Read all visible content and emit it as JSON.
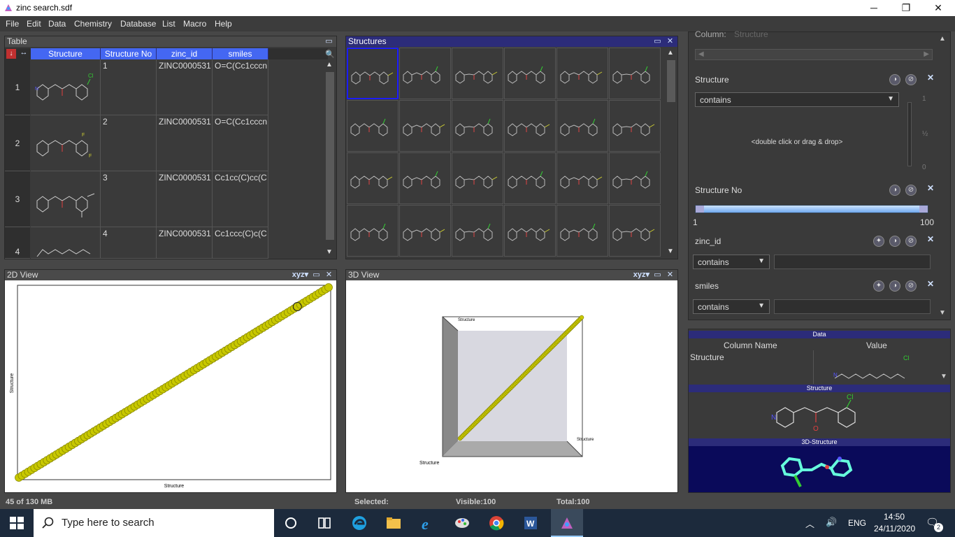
{
  "window": {
    "title": "zinc search.sdf",
    "minimize": "─",
    "restore": "❐",
    "close": "✕"
  },
  "menu": [
    "File",
    "Edit",
    "Data",
    "Chemistry",
    "Database",
    "List",
    "Macro",
    "Help"
  ],
  "table_panel": {
    "title": "Table",
    "columns": [
      "Structure",
      "Structure No",
      "zinc_id",
      "smiles"
    ],
    "rows": [
      {
        "num": "1",
        "structure_no": "1",
        "zinc_id": "ZINC0000531",
        "smiles": "O=C(Cc1cccn"
      },
      {
        "num": "2",
        "structure_no": "2",
        "zinc_id": "ZINC0000531",
        "smiles": "O=C(Cc1cccn"
      },
      {
        "num": "3",
        "structure_no": "3",
        "zinc_id": "ZINC0000531",
        "smiles": "Cc1cc(C)cc(C"
      },
      {
        "num": "4",
        "structure_no": "4",
        "zinc_id": "ZINC0000531",
        "smiles": "Cc1ccc(C)c(C"
      }
    ]
  },
  "structures_panel": {
    "title": "Structures"
  },
  "view2d": {
    "title": "2D View",
    "xyz": "xyz",
    "xlabel": "Structure",
    "ylabel": "Structure"
  },
  "view3d": {
    "title": "3D View",
    "xyz": "xyz",
    "axis_top": "Structure",
    "axis_right": "Structure",
    "axis_bottom": "Structure"
  },
  "query_panel": {
    "column_label": "Column:",
    "column_value": "Structure",
    "structure": {
      "label": "Structure",
      "mode": "contains",
      "hint": "<double click or drag & drop>",
      "slider_labels": [
        "1",
        "½",
        "0"
      ]
    },
    "structure_no": {
      "label": "Structure No",
      "min": "1",
      "max": "100"
    },
    "zinc_id": {
      "label": "zinc_id",
      "mode": "contains"
    },
    "smiles": {
      "label": "smiles",
      "mode": "contains"
    }
  },
  "data_panel": {
    "title": "Data",
    "col_name_header": "Column Name",
    "value_header": "Value",
    "row_name": "Structure",
    "structure_label": "Structure",
    "structure3d_label": "3D-Structure"
  },
  "status": {
    "memory": "45 of 130 MB",
    "selected": "Selected:",
    "visible": "Visible:100",
    "total": "Total:100"
  },
  "taskbar": {
    "search_placeholder": "Type here to search",
    "lang": "ENG",
    "time": "14:50",
    "date": "24/11/2020",
    "notif": "2"
  },
  "colors": {
    "accent": "#4467f2",
    "panel_title": "#2c2c7a",
    "points": "#c8c800"
  },
  "chart_data": [
    {
      "type": "scatter",
      "title": "2D View",
      "xlabel": "Structure",
      "ylabel": "Structure",
      "x": [
        1,
        2,
        3,
        4,
        5,
        6,
        7,
        8,
        9,
        10,
        11,
        12,
        13,
        14,
        15,
        16,
        17,
        18,
        19,
        20,
        21,
        22,
        23,
        24,
        25,
        26,
        27,
        28,
        29,
        30,
        31,
        32,
        33,
        34,
        35,
        36,
        37,
        38,
        39,
        40,
        41,
        42,
        43,
        44,
        45,
        46,
        47,
        48,
        49,
        50,
        51,
        52,
        53,
        54,
        55,
        56,
        57,
        58,
        59,
        60,
        61,
        62,
        63,
        64,
        65,
        66,
        67,
        68,
        69,
        70,
        71,
        72,
        73,
        74,
        75,
        76,
        77,
        78,
        79,
        80,
        81,
        82,
        83,
        84,
        85,
        86,
        87,
        88,
        89,
        90,
        91,
        92,
        93,
        94,
        95,
        96,
        97,
        98,
        99,
        100
      ],
      "y": [
        1,
        2,
        3,
        4,
        5,
        6,
        7,
        8,
        9,
        10,
        11,
        12,
        13,
        14,
        15,
        16,
        17,
        18,
        19,
        20,
        21,
        22,
        23,
        24,
        25,
        26,
        27,
        28,
        29,
        30,
        31,
        32,
        33,
        34,
        35,
        36,
        37,
        38,
        39,
        40,
        41,
        42,
        43,
        44,
        45,
        46,
        47,
        48,
        49,
        50,
        51,
        52,
        53,
        54,
        55,
        56,
        57,
        58,
        59,
        60,
        61,
        62,
        63,
        64,
        65,
        66,
        67,
        68,
        69,
        70,
        71,
        72,
        73,
        74,
        75,
        76,
        77,
        78,
        79,
        80,
        81,
        82,
        83,
        84,
        85,
        86,
        87,
        88,
        89,
        90,
        91,
        92,
        93,
        94,
        95,
        96,
        97,
        98,
        99,
        100
      ],
      "xlim": [
        1,
        100
      ],
      "ylim": [
        1,
        100
      ],
      "highlighted_x": 90
    }
  ]
}
